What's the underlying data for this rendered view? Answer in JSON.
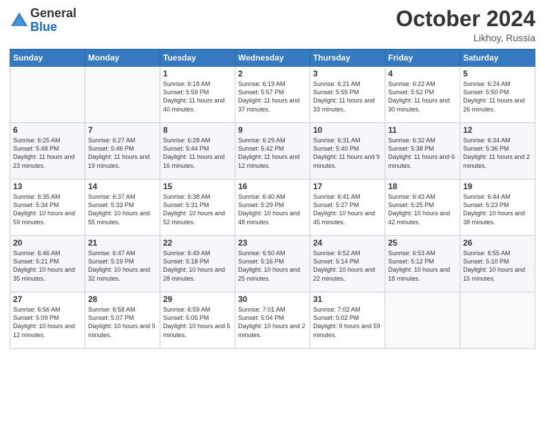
{
  "logo": {
    "general": "General",
    "blue": "Blue"
  },
  "header": {
    "month": "October 2024",
    "location": "Likhoy, Russia"
  },
  "weekdays": [
    "Sunday",
    "Monday",
    "Tuesday",
    "Wednesday",
    "Thursday",
    "Friday",
    "Saturday"
  ],
  "weeks": [
    [
      {
        "day": "",
        "sunrise": "",
        "sunset": "",
        "daylight": ""
      },
      {
        "day": "",
        "sunrise": "",
        "sunset": "",
        "daylight": ""
      },
      {
        "day": "1",
        "sunrise": "Sunrise: 6:18 AM",
        "sunset": "Sunset: 5:59 PM",
        "daylight": "Daylight: 11 hours and 40 minutes."
      },
      {
        "day": "2",
        "sunrise": "Sunrise: 6:19 AM",
        "sunset": "Sunset: 5:57 PM",
        "daylight": "Daylight: 11 hours and 37 minutes."
      },
      {
        "day": "3",
        "sunrise": "Sunrise: 6:21 AM",
        "sunset": "Sunset: 5:55 PM",
        "daylight": "Daylight: 11 hours and 33 minutes."
      },
      {
        "day": "4",
        "sunrise": "Sunrise: 6:22 AM",
        "sunset": "Sunset: 5:52 PM",
        "daylight": "Daylight: 11 hours and 30 minutes."
      },
      {
        "day": "5",
        "sunrise": "Sunrise: 6:24 AM",
        "sunset": "Sunset: 5:50 PM",
        "daylight": "Daylight: 11 hours and 26 minutes."
      }
    ],
    [
      {
        "day": "6",
        "sunrise": "Sunrise: 6:25 AM",
        "sunset": "Sunset: 5:48 PM",
        "daylight": "Daylight: 11 hours and 23 minutes."
      },
      {
        "day": "7",
        "sunrise": "Sunrise: 6:27 AM",
        "sunset": "Sunset: 5:46 PM",
        "daylight": "Daylight: 11 hours and 19 minutes."
      },
      {
        "day": "8",
        "sunrise": "Sunrise: 6:28 AM",
        "sunset": "Sunset: 5:44 PM",
        "daylight": "Daylight: 11 hours and 16 minutes."
      },
      {
        "day": "9",
        "sunrise": "Sunrise: 6:29 AM",
        "sunset": "Sunset: 5:42 PM",
        "daylight": "Daylight: 11 hours and 12 minutes."
      },
      {
        "day": "10",
        "sunrise": "Sunrise: 6:31 AM",
        "sunset": "Sunset: 5:40 PM",
        "daylight": "Daylight: 11 hours and 9 minutes."
      },
      {
        "day": "11",
        "sunrise": "Sunrise: 6:32 AM",
        "sunset": "Sunset: 5:38 PM",
        "daylight": "Daylight: 11 hours and 6 minutes."
      },
      {
        "day": "12",
        "sunrise": "Sunrise: 6:34 AM",
        "sunset": "Sunset: 5:36 PM",
        "daylight": "Daylight: 11 hours and 2 minutes."
      }
    ],
    [
      {
        "day": "13",
        "sunrise": "Sunrise: 6:35 AM",
        "sunset": "Sunset: 5:34 PM",
        "daylight": "Daylight: 10 hours and 59 minutes."
      },
      {
        "day": "14",
        "sunrise": "Sunrise: 6:37 AM",
        "sunset": "Sunset: 5:33 PM",
        "daylight": "Daylight: 10 hours and 55 minutes."
      },
      {
        "day": "15",
        "sunrise": "Sunrise: 6:38 AM",
        "sunset": "Sunset: 5:31 PM",
        "daylight": "Daylight: 10 hours and 52 minutes."
      },
      {
        "day": "16",
        "sunrise": "Sunrise: 6:40 AM",
        "sunset": "Sunset: 5:29 PM",
        "daylight": "Daylight: 10 hours and 48 minutes."
      },
      {
        "day": "17",
        "sunrise": "Sunrise: 6:41 AM",
        "sunset": "Sunset: 5:27 PM",
        "daylight": "Daylight: 10 hours and 45 minutes."
      },
      {
        "day": "18",
        "sunrise": "Sunrise: 6:43 AM",
        "sunset": "Sunset: 5:25 PM",
        "daylight": "Daylight: 10 hours and 42 minutes."
      },
      {
        "day": "19",
        "sunrise": "Sunrise: 6:44 AM",
        "sunset": "Sunset: 5:23 PM",
        "daylight": "Daylight: 10 hours and 38 minutes."
      }
    ],
    [
      {
        "day": "20",
        "sunrise": "Sunrise: 6:46 AM",
        "sunset": "Sunset: 5:21 PM",
        "daylight": "Daylight: 10 hours and 35 minutes."
      },
      {
        "day": "21",
        "sunrise": "Sunrise: 6:47 AM",
        "sunset": "Sunset: 5:19 PM",
        "daylight": "Daylight: 10 hours and 32 minutes."
      },
      {
        "day": "22",
        "sunrise": "Sunrise: 6:49 AM",
        "sunset": "Sunset: 5:18 PM",
        "daylight": "Daylight: 10 hours and 28 minutes."
      },
      {
        "day": "23",
        "sunrise": "Sunrise: 6:50 AM",
        "sunset": "Sunset: 5:16 PM",
        "daylight": "Daylight: 10 hours and 25 minutes."
      },
      {
        "day": "24",
        "sunrise": "Sunrise: 6:52 AM",
        "sunset": "Sunset: 5:14 PM",
        "daylight": "Daylight: 10 hours and 22 minutes."
      },
      {
        "day": "25",
        "sunrise": "Sunrise: 6:53 AM",
        "sunset": "Sunset: 5:12 PM",
        "daylight": "Daylight: 10 hours and 18 minutes."
      },
      {
        "day": "26",
        "sunrise": "Sunrise: 6:55 AM",
        "sunset": "Sunset: 5:10 PM",
        "daylight": "Daylight: 10 hours and 15 minutes."
      }
    ],
    [
      {
        "day": "27",
        "sunrise": "Sunrise: 6:56 AM",
        "sunset": "Sunset: 5:09 PM",
        "daylight": "Daylight: 10 hours and 12 minutes."
      },
      {
        "day": "28",
        "sunrise": "Sunrise: 6:58 AM",
        "sunset": "Sunset: 5:07 PM",
        "daylight": "Daylight: 10 hours and 9 minutes."
      },
      {
        "day": "29",
        "sunrise": "Sunrise: 6:59 AM",
        "sunset": "Sunset: 5:05 PM",
        "daylight": "Daylight: 10 hours and 5 minutes."
      },
      {
        "day": "30",
        "sunrise": "Sunrise: 7:01 AM",
        "sunset": "Sunset: 5:04 PM",
        "daylight": "Daylight: 10 hours and 2 minutes."
      },
      {
        "day": "31",
        "sunrise": "Sunrise: 7:02 AM",
        "sunset": "Sunset: 5:02 PM",
        "daylight": "Daylight: 9 hours and 59 minutes."
      },
      {
        "day": "",
        "sunrise": "",
        "sunset": "",
        "daylight": ""
      },
      {
        "day": "",
        "sunrise": "",
        "sunset": "",
        "daylight": ""
      }
    ]
  ]
}
